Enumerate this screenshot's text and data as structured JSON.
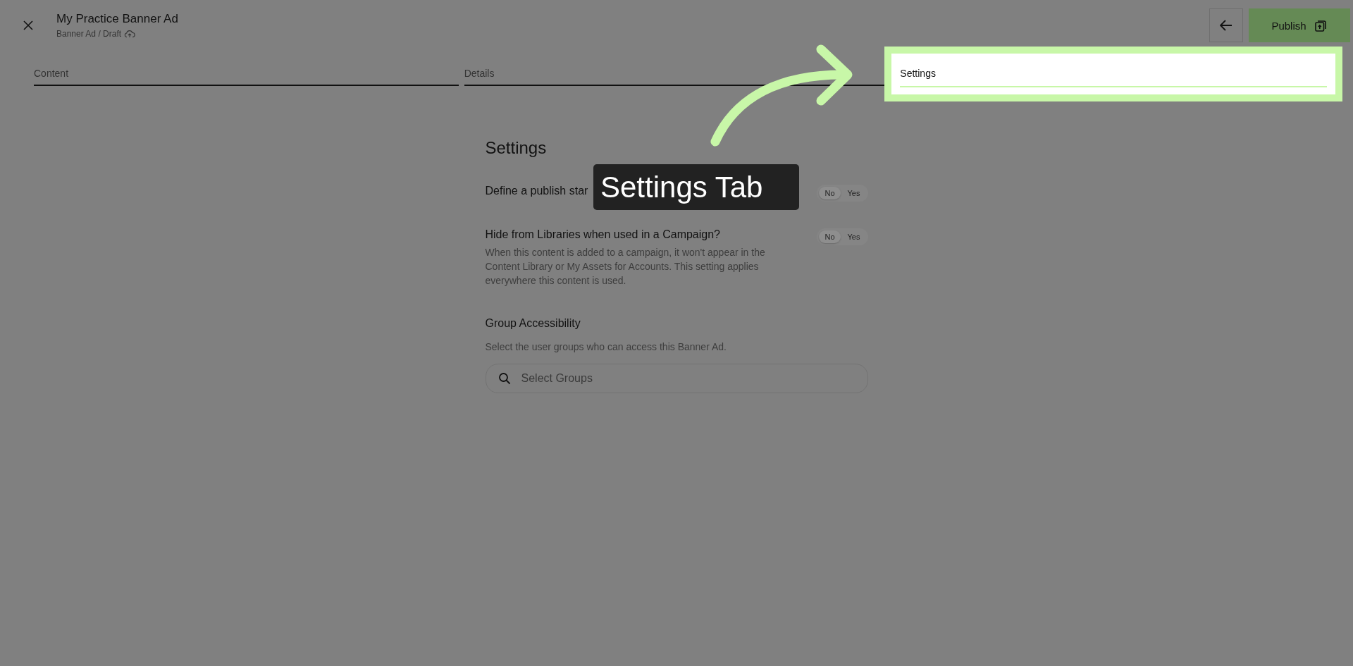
{
  "header": {
    "title": "My Practice Banner Ad",
    "breadcrumb": "Banner Ad / Draft"
  },
  "actions": {
    "publish": "Publish"
  },
  "tabs": [
    {
      "label": "Content",
      "selected": false
    },
    {
      "label": "Details",
      "selected": false
    },
    {
      "label": "Settings",
      "selected": true
    }
  ],
  "section_title": "Settings",
  "settings": [
    {
      "label": "Define a publish star",
      "options": [
        {
          "label": "No",
          "selected": true
        },
        {
          "label": "Yes",
          "selected": false
        }
      ]
    },
    {
      "label": "Hide from Libraries when used in a Campaign?",
      "description": "When this content is added to a campaign, it won't appear in the Content Library or My Assets for Accounts. This setting applies everywhere this content is used.",
      "options": [
        {
          "label": "No",
          "selected": true
        },
        {
          "label": "Yes",
          "selected": false
        }
      ]
    }
  ],
  "group_access": {
    "title": "Group Accessibility",
    "description": "Select the user groups who can access this Banner Ad.",
    "placeholder": "Select Groups"
  },
  "callout": {
    "text": "Settings Tab"
  }
}
